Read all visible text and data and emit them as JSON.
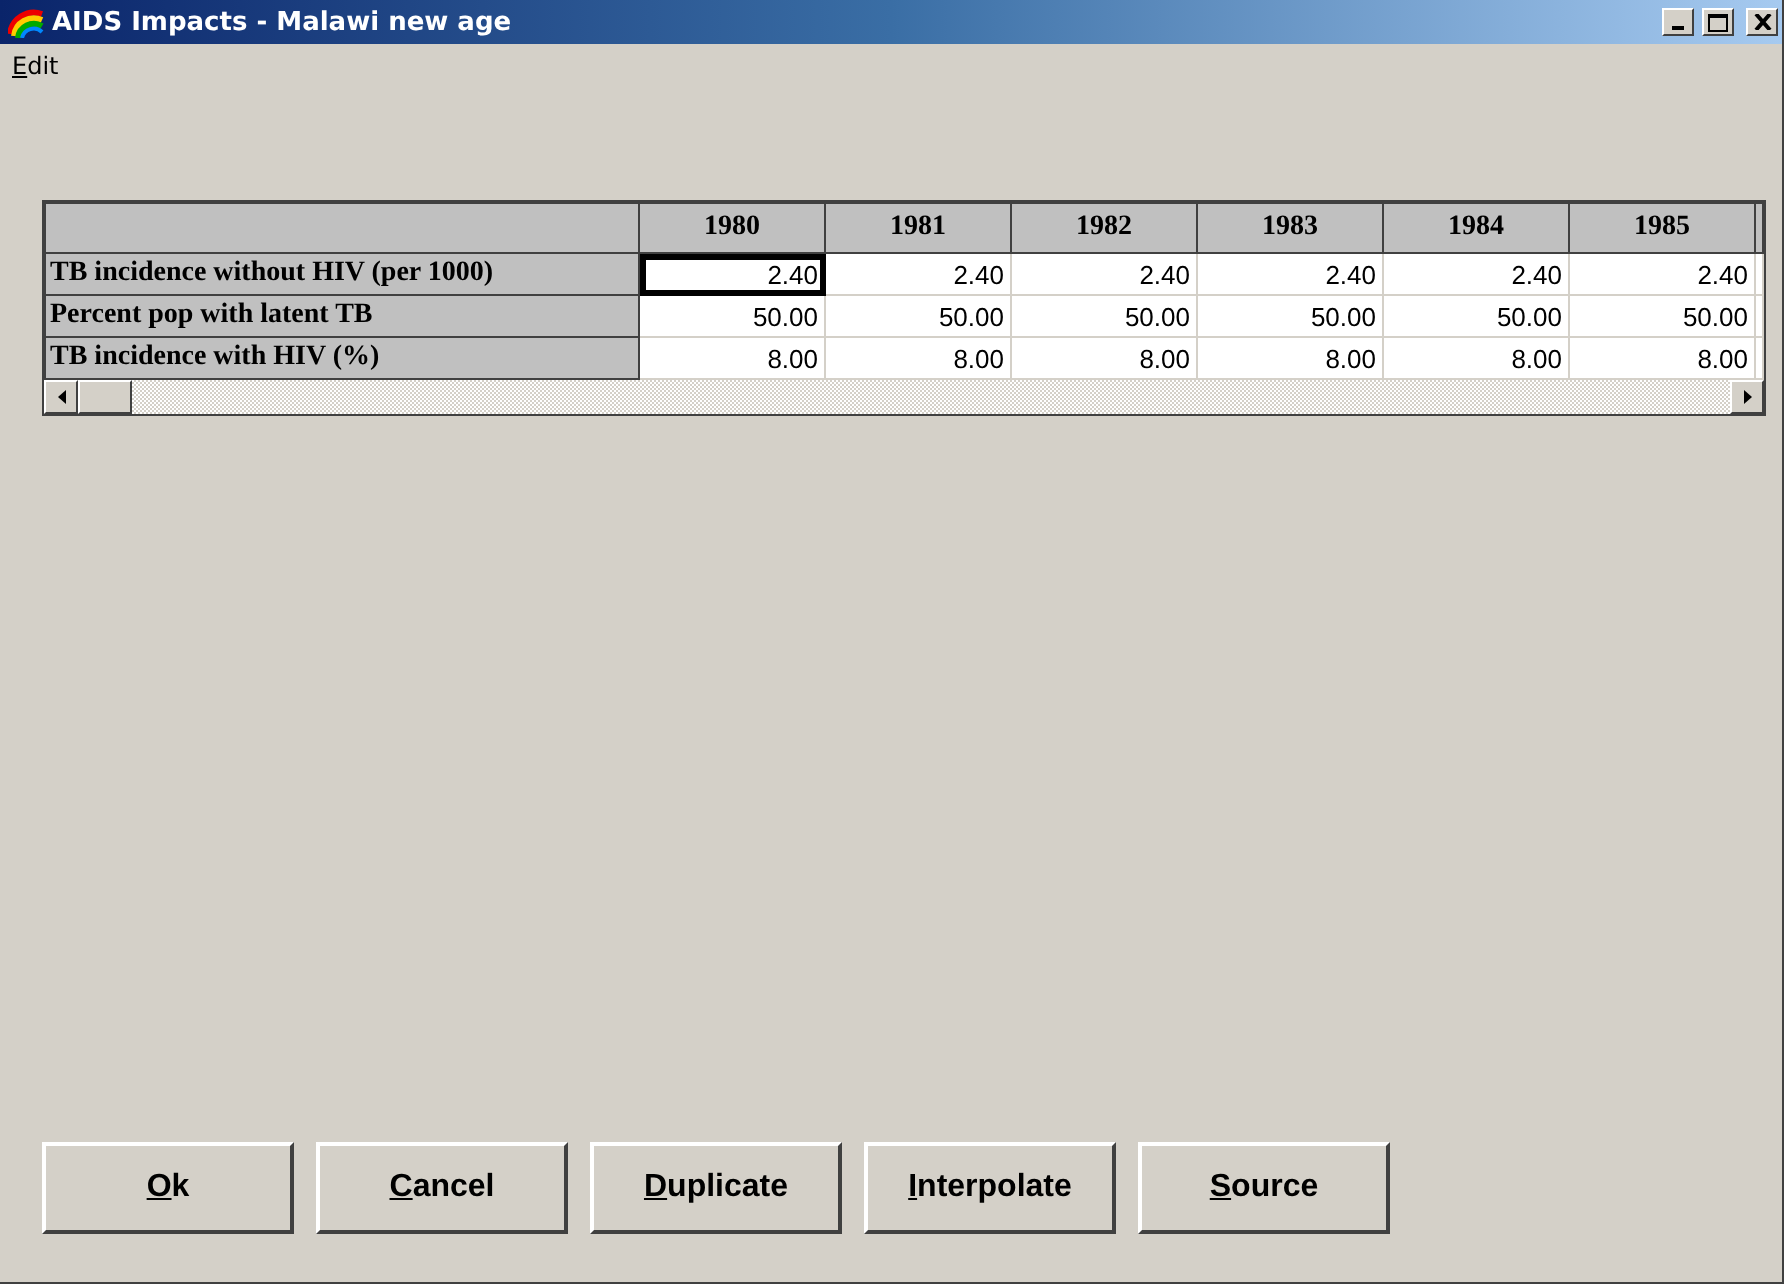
{
  "window": {
    "title": "AIDS Impacts - Malawi new age"
  },
  "menu": [
    {
      "label": "Edit"
    }
  ],
  "table": {
    "columns": [
      "1980",
      "1981",
      "1982",
      "1983",
      "1984",
      "1985"
    ],
    "rows": [
      {
        "label": "TB incidence without HIV (per 1000)",
        "cells": [
          {
            "value": "2.40",
            "selected": true
          },
          {
            "value": "2.40",
            "selected": false
          },
          {
            "value": "2.40",
            "selected": false
          },
          {
            "value": "2.40",
            "selected": false
          },
          {
            "value": "2.40",
            "selected": false
          },
          {
            "value": "2.40",
            "selected": false
          }
        ]
      },
      {
        "label": "Percent pop with latent TB",
        "cells": [
          {
            "value": "50.00",
            "selected": false
          },
          {
            "value": "50.00",
            "selected": false
          },
          {
            "value": "50.00",
            "selected": false
          },
          {
            "value": "50.00",
            "selected": false
          },
          {
            "value": "50.00",
            "selected": false
          },
          {
            "value": "50.00",
            "selected": false
          }
        ]
      },
      {
        "label": "TB incidence with HIV (%)",
        "cells": [
          {
            "value": "8.00",
            "selected": false
          },
          {
            "value": "8.00",
            "selected": false
          },
          {
            "value": "8.00",
            "selected": false
          },
          {
            "value": "8.00",
            "selected": false
          },
          {
            "value": "8.00",
            "selected": false
          },
          {
            "value": "8.00",
            "selected": false
          }
        ]
      }
    ]
  },
  "buttons": [
    {
      "label": "Ok"
    },
    {
      "label": "Cancel"
    },
    {
      "label": "Duplicate"
    },
    {
      "label": "Interpolate"
    },
    {
      "label": "Source"
    }
  ]
}
